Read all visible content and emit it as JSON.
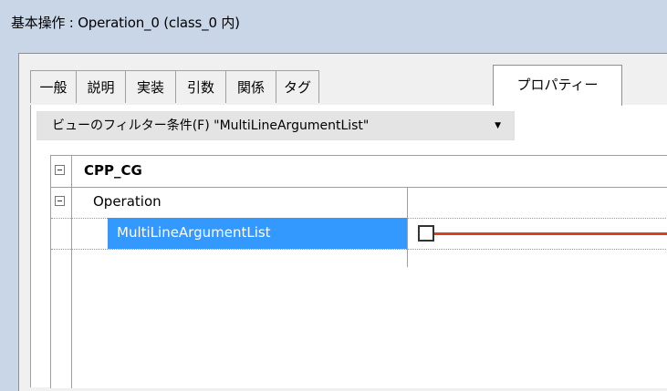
{
  "window": {
    "title": "基本操作 : Operation_0 (class_0 内)"
  },
  "tabs": [
    {
      "label": "一般"
    },
    {
      "label": "説明"
    },
    {
      "label": "実装"
    },
    {
      "label": "引数"
    },
    {
      "label": "関係"
    },
    {
      "label": "タグ"
    },
    {
      "label": "プロパティー",
      "active": true
    }
  ],
  "filter": {
    "label": "ビューのフィルター条件(F) \"MultiLineArgumentList\"",
    "dropdown_icon": "chevron-down-icon"
  },
  "grid": {
    "category": "CPP_CG",
    "group": "Operation",
    "property": {
      "name": "MultiLineArgumentList",
      "checked": false
    }
  },
  "colors": {
    "selection": "#3399ff",
    "annotation_line": "#d9411e",
    "background": "#c8d6e8"
  }
}
